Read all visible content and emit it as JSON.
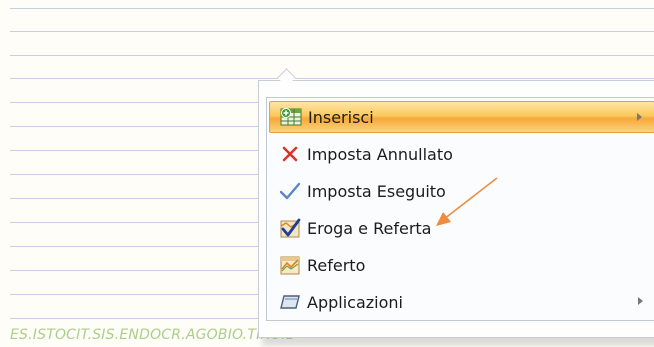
{
  "background": {
    "footer_text": "ES.ISTOCIT.SIS.ENDOCR.AGOBIO.TIROID"
  },
  "menu": {
    "items": [
      {
        "label": "Inserisci",
        "icon": "table-insert-icon",
        "has_submenu": true,
        "active": true
      },
      {
        "label": "Imposta Annullato",
        "icon": "red-x-icon",
        "has_submenu": false,
        "active": false
      },
      {
        "label": "Imposta Eseguito",
        "icon": "checkmark-icon",
        "has_submenu": false,
        "active": false
      },
      {
        "label": "Eroga e Referta",
        "icon": "dispense-report-icon",
        "has_submenu": false,
        "active": false
      },
      {
        "label": "Referto",
        "icon": "report-icon",
        "has_submenu": false,
        "active": false
      },
      {
        "label": "Applicazioni",
        "icon": "applications-icon",
        "has_submenu": true,
        "active": false
      }
    ]
  },
  "colors": {
    "highlight": "#f7a83c",
    "annotation_arrow": "#f08a3c",
    "grid_line": "#c4d2e3"
  }
}
